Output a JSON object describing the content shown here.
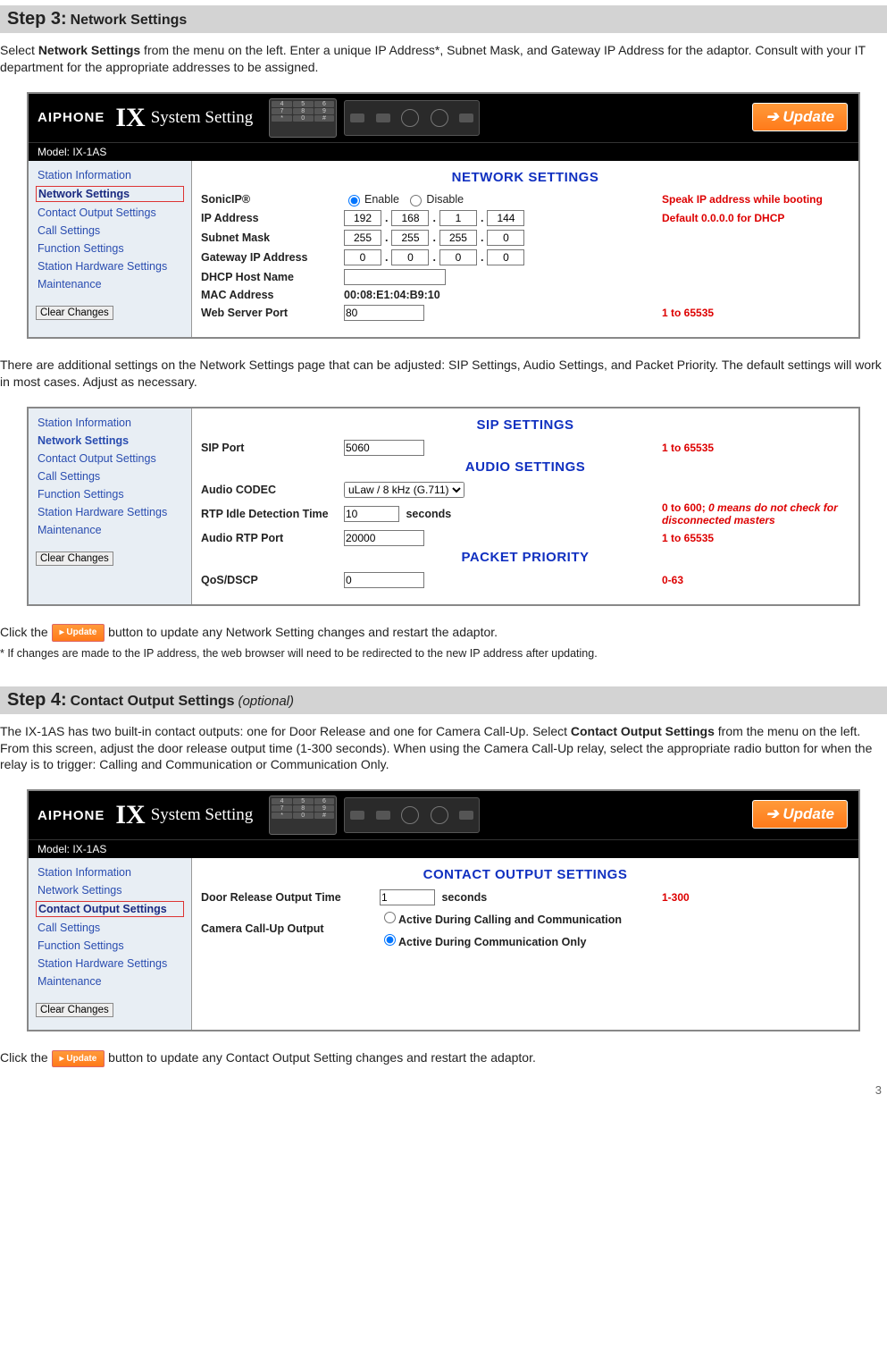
{
  "page_number": "3",
  "steps": {
    "s3": {
      "num": "Step 3:",
      "title": "Network Settings"
    },
    "s4": {
      "num": "Step 4:",
      "title": "Contact Output Settings",
      "opt": "(optional)"
    }
  },
  "text": {
    "p1a": "Select ",
    "p1b": "Network Settings",
    "p1c": " from the menu on the left. Enter a unique IP Address*, Subnet Mask, and Gateway IP Address for the adaptor. Consult with your IT department for the appropriate addresses to be assigned.",
    "p2": "There are additional settings on the Network Settings page that can be adjusted: SIP Settings, Audio Settings, and Packet Priority. The default settings will work in most cases. Adjust as necessary.",
    "p3a": "Click the ",
    "p3b": " button to update any Network Setting changes and restart the adaptor.",
    "p3note": "* If changes are made to the IP address, the web browser will need to be redirected to the new IP address after updating.",
    "p4a": "The IX-1AS has two built-in contact outputs: one for Door Release and one for Camera Call-Up. Select ",
    "p4b": "Contact Output Settings",
    "p4c": " from the menu on the left. From this screen, adjust the door release output time (1-300 seconds). When using the Camera Call-Up relay, select the appropriate radio button for when the relay is to trigger: Calling and Communication or Communication Only.",
    "p5a": "Click the ",
    "p5b": " button to update any Contact Output Setting changes and restart the adaptor.",
    "inline_update": "Update"
  },
  "header": {
    "brand": "AIPHONE",
    "ix": "IX",
    "sys": "System Setting",
    "update": "Update",
    "model": "Model: IX-1AS"
  },
  "sidebar_items": [
    "Station Information",
    "Network Settings",
    "Contact Output Settings",
    "Call Settings",
    "Function Settings",
    "Station Hardware Settings",
    "Maintenance"
  ],
  "clear_btn": "Clear Changes",
  "network": {
    "title": "NETWORK SETTINGS",
    "sonicip": {
      "lbl": "SonicIP®",
      "enable": "Enable",
      "disable": "Disable",
      "hint": "Speak IP address while booting"
    },
    "ip": {
      "lbl": "IP Address",
      "v": [
        "192",
        "168",
        "1",
        "144"
      ],
      "hint": "Default 0.0.0.0 for DHCP"
    },
    "mask": {
      "lbl": "Subnet Mask",
      "v": [
        "255",
        "255",
        "255",
        "0"
      ]
    },
    "gw": {
      "lbl": "Gateway IP Address",
      "v": [
        "0",
        "0",
        "0",
        "0"
      ]
    },
    "dhcp": {
      "lbl": "DHCP Host Name",
      "v": ""
    },
    "mac": {
      "lbl": "MAC Address",
      "v": "00:08:E1:04:B9:10"
    },
    "port": {
      "lbl": "Web Server Port",
      "v": "80",
      "hint": "1 to 65535"
    }
  },
  "sip": {
    "title": "SIP SETTINGS",
    "port": {
      "lbl": "SIP Port",
      "v": "5060",
      "hint": "1 to 65535"
    }
  },
  "audio": {
    "title": "AUDIO SETTINGS",
    "codec": {
      "lbl": "Audio CODEC",
      "v": "uLaw / 8 kHz (G.711)"
    },
    "rtpidle": {
      "lbl": "RTP Idle Detection Time",
      "v": "10",
      "unit": "seconds",
      "hint_a": "0 to 600; ",
      "hint_b": "0 means do not check for disconnected masters"
    },
    "rtpport": {
      "lbl": "Audio RTP Port",
      "v": "20000",
      "hint": "1 to 65535"
    }
  },
  "packet": {
    "title": "PACKET PRIORITY",
    "qos": {
      "lbl": "QoS/DSCP",
      "v": "0",
      "hint": "0-63"
    }
  },
  "contact": {
    "title": "CONTACT OUTPUT SETTINGS",
    "door": {
      "lbl": "Door Release Output Time",
      "v": "1",
      "unit": "seconds",
      "hint": "1-300"
    },
    "cam": {
      "lbl": "Camera Call-Up Output",
      "opt1": "Active During Calling and Communication",
      "opt2": "Active During Communication Only"
    }
  }
}
